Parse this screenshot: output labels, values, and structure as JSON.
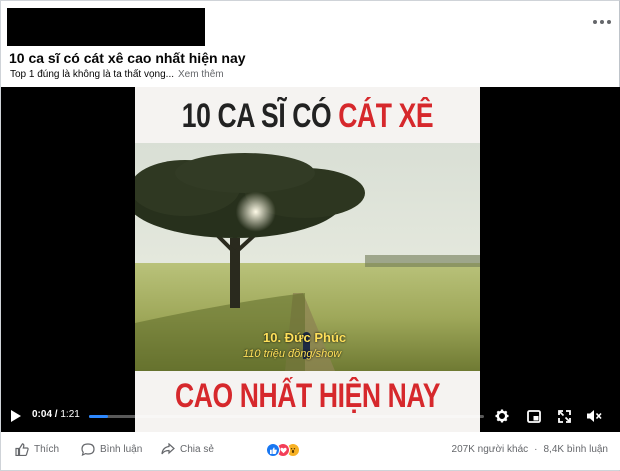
{
  "post": {
    "title": "10 ca sĩ có cát xê cao nhất hiện nay",
    "caption": "Top 1 đúng là không là ta thất vọng...",
    "see_more": "Xem thêm"
  },
  "video": {
    "frame_title_part1": "10 CA SĨ CÓ",
    "frame_title_part2": "CÁT XÊ",
    "frame_bottom_title": "CAO NHẤT HIỆN NAY",
    "overlay_name": "10. Đức Phúc",
    "overlay_fee": "110 triệu đồng/show",
    "current_time": "0:04",
    "duration": "1:21",
    "progress_fraction": 0.049,
    "colors": {
      "accent": "#2d88ff",
      "title_red": "#d6282c",
      "overlay_yellow": "#ffe05a"
    }
  },
  "actions": {
    "like_label": "Thích",
    "comment_label": "Bình luận",
    "share_label": "Chia sẻ"
  },
  "stats": {
    "reactions_text": "207K người khác",
    "separator": "·",
    "comments_text": "8,4K bình luận",
    "reaction_icons": [
      "like-icon",
      "love-icon",
      "wow-icon"
    ]
  }
}
